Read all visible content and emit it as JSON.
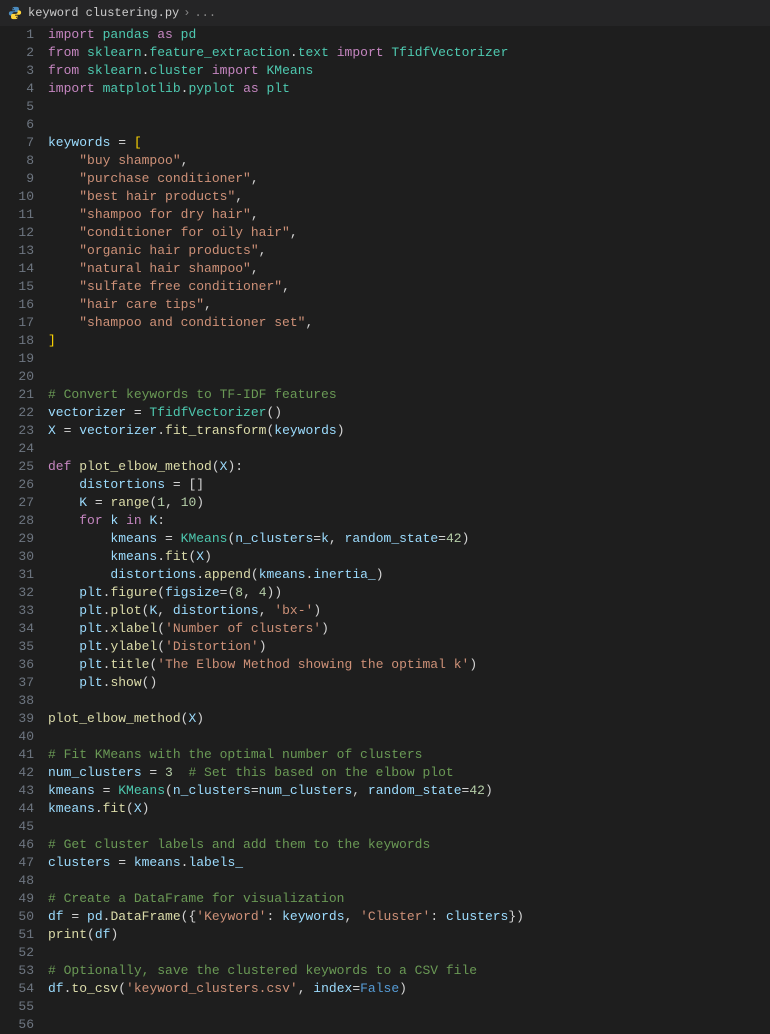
{
  "tab": {
    "filename": "keyword clustering.py",
    "crumb2": "..."
  },
  "lines": [
    {
      "n": 1,
      "ind": 0,
      "tokens": [
        [
          "kw",
          "import"
        ],
        [
          "op",
          " "
        ],
        [
          "mod",
          "pandas"
        ],
        [
          "op",
          " "
        ],
        [
          "kw",
          "as"
        ],
        [
          "op",
          " "
        ],
        [
          "mod",
          "pd"
        ]
      ]
    },
    {
      "n": 2,
      "ind": 0,
      "tokens": [
        [
          "kw",
          "from"
        ],
        [
          "op",
          " "
        ],
        [
          "mod",
          "sklearn"
        ],
        [
          "punc",
          "."
        ],
        [
          "mod",
          "feature_extraction"
        ],
        [
          "punc",
          "."
        ],
        [
          "mod",
          "text"
        ],
        [
          "op",
          " "
        ],
        [
          "kw",
          "import"
        ],
        [
          "op",
          " "
        ],
        [
          "mod",
          "TfidfVectorizer"
        ]
      ]
    },
    {
      "n": 3,
      "ind": 0,
      "tokens": [
        [
          "kw",
          "from"
        ],
        [
          "op",
          " "
        ],
        [
          "mod",
          "sklearn"
        ],
        [
          "punc",
          "."
        ],
        [
          "mod",
          "cluster"
        ],
        [
          "op",
          " "
        ],
        [
          "kw",
          "import"
        ],
        [
          "op",
          " "
        ],
        [
          "mod",
          "KMeans"
        ]
      ]
    },
    {
      "n": 4,
      "ind": 0,
      "tokens": [
        [
          "kw",
          "import"
        ],
        [
          "op",
          " "
        ],
        [
          "mod",
          "matplotlib"
        ],
        [
          "punc",
          "."
        ],
        [
          "mod",
          "pyplot"
        ],
        [
          "op",
          " "
        ],
        [
          "kw",
          "as"
        ],
        [
          "op",
          " "
        ],
        [
          "mod",
          "plt"
        ]
      ]
    },
    {
      "n": 5,
      "ind": 0,
      "tokens": []
    },
    {
      "n": 6,
      "ind": 0,
      "tokens": []
    },
    {
      "n": 7,
      "ind": 0,
      "tokens": [
        [
          "var",
          "keywords"
        ],
        [
          "op",
          " = "
        ],
        [
          "brk",
          "["
        ]
      ]
    },
    {
      "n": 8,
      "ind": 1,
      "tokens": [
        [
          "str",
          "\"buy shampoo\""
        ],
        [
          "punc",
          ","
        ]
      ]
    },
    {
      "n": 9,
      "ind": 1,
      "tokens": [
        [
          "str",
          "\"purchase conditioner\""
        ],
        [
          "punc",
          ","
        ]
      ]
    },
    {
      "n": 10,
      "ind": 1,
      "tokens": [
        [
          "str",
          "\"best hair products\""
        ],
        [
          "punc",
          ","
        ]
      ]
    },
    {
      "n": 11,
      "ind": 1,
      "tokens": [
        [
          "str",
          "\"shampoo for dry hair\""
        ],
        [
          "punc",
          ","
        ]
      ]
    },
    {
      "n": 12,
      "ind": 1,
      "tokens": [
        [
          "str",
          "\"conditioner for oily hair\""
        ],
        [
          "punc",
          ","
        ]
      ]
    },
    {
      "n": 13,
      "ind": 1,
      "tokens": [
        [
          "str",
          "\"organic hair products\""
        ],
        [
          "punc",
          ","
        ]
      ]
    },
    {
      "n": 14,
      "ind": 1,
      "tokens": [
        [
          "str",
          "\"natural hair shampoo\""
        ],
        [
          "punc",
          ","
        ]
      ]
    },
    {
      "n": 15,
      "ind": 1,
      "tokens": [
        [
          "str",
          "\"sulfate free conditioner\""
        ],
        [
          "punc",
          ","
        ]
      ]
    },
    {
      "n": 16,
      "ind": 1,
      "tokens": [
        [
          "str",
          "\"hair care tips\""
        ],
        [
          "punc",
          ","
        ]
      ]
    },
    {
      "n": 17,
      "ind": 1,
      "tokens": [
        [
          "str",
          "\"shampoo and conditioner set\""
        ],
        [
          "punc",
          ","
        ]
      ]
    },
    {
      "n": 18,
      "ind": 0,
      "tokens": [
        [
          "brk",
          "]"
        ]
      ]
    },
    {
      "n": 19,
      "ind": 0,
      "tokens": []
    },
    {
      "n": 20,
      "ind": 0,
      "tokens": []
    },
    {
      "n": 21,
      "ind": 0,
      "tokens": [
        [
          "cmt",
          "# Convert keywords to TF-IDF features"
        ]
      ]
    },
    {
      "n": 22,
      "ind": 0,
      "tokens": [
        [
          "var",
          "vectorizer"
        ],
        [
          "op",
          " = "
        ],
        [
          "mod",
          "TfidfVectorizer"
        ],
        [
          "punc",
          "()"
        ]
      ]
    },
    {
      "n": 23,
      "ind": 0,
      "tokens": [
        [
          "var",
          "X"
        ],
        [
          "op",
          " = "
        ],
        [
          "var",
          "vectorizer"
        ],
        [
          "punc",
          "."
        ],
        [
          "fn",
          "fit_transform"
        ],
        [
          "punc",
          "("
        ],
        [
          "var",
          "keywords"
        ],
        [
          "punc",
          ")"
        ]
      ]
    },
    {
      "n": 24,
      "ind": 0,
      "tokens": []
    },
    {
      "n": 25,
      "ind": 0,
      "tokens": [
        [
          "kw",
          "def"
        ],
        [
          "op",
          " "
        ],
        [
          "fn",
          "plot_elbow_method"
        ],
        [
          "punc",
          "("
        ],
        [
          "var",
          "X"
        ],
        [
          "punc",
          "):"
        ]
      ]
    },
    {
      "n": 26,
      "ind": 1,
      "tokens": [
        [
          "var",
          "distortions"
        ],
        [
          "op",
          " = "
        ],
        [
          "punc",
          "[]"
        ]
      ]
    },
    {
      "n": 27,
      "ind": 1,
      "tokens": [
        [
          "var",
          "K"
        ],
        [
          "op",
          " = "
        ],
        [
          "fn",
          "range"
        ],
        [
          "punc",
          "("
        ],
        [
          "num",
          "1"
        ],
        [
          "punc",
          ", "
        ],
        [
          "num",
          "10"
        ],
        [
          "punc",
          ")"
        ]
      ]
    },
    {
      "n": 28,
      "ind": 1,
      "tokens": [
        [
          "kw",
          "for"
        ],
        [
          "op",
          " "
        ],
        [
          "var",
          "k"
        ],
        [
          "op",
          " "
        ],
        [
          "kw",
          "in"
        ],
        [
          "op",
          " "
        ],
        [
          "var",
          "K"
        ],
        [
          "punc",
          ":"
        ]
      ]
    },
    {
      "n": 29,
      "ind": 2,
      "tokens": [
        [
          "var",
          "kmeans"
        ],
        [
          "op",
          " = "
        ],
        [
          "mod",
          "KMeans"
        ],
        [
          "punc",
          "("
        ],
        [
          "var",
          "n_clusters"
        ],
        [
          "op",
          "="
        ],
        [
          "var",
          "k"
        ],
        [
          "punc",
          ", "
        ],
        [
          "var",
          "random_state"
        ],
        [
          "op",
          "="
        ],
        [
          "num",
          "42"
        ],
        [
          "punc",
          ")"
        ]
      ]
    },
    {
      "n": 30,
      "ind": 2,
      "tokens": [
        [
          "var",
          "kmeans"
        ],
        [
          "punc",
          "."
        ],
        [
          "fn",
          "fit"
        ],
        [
          "punc",
          "("
        ],
        [
          "var",
          "X"
        ],
        [
          "punc",
          ")"
        ]
      ]
    },
    {
      "n": 31,
      "ind": 2,
      "tokens": [
        [
          "var",
          "distortions"
        ],
        [
          "punc",
          "."
        ],
        [
          "fn",
          "append"
        ],
        [
          "punc",
          "("
        ],
        [
          "var",
          "kmeans"
        ],
        [
          "punc",
          "."
        ],
        [
          "var",
          "inertia_"
        ],
        [
          "punc",
          ")"
        ]
      ]
    },
    {
      "n": 32,
      "ind": 1,
      "tokens": [
        [
          "var",
          "plt"
        ],
        [
          "punc",
          "."
        ],
        [
          "fn",
          "figure"
        ],
        [
          "punc",
          "("
        ],
        [
          "var",
          "figsize"
        ],
        [
          "op",
          "="
        ],
        [
          "punc",
          "("
        ],
        [
          "num",
          "8"
        ],
        [
          "punc",
          ", "
        ],
        [
          "num",
          "4"
        ],
        [
          "punc",
          "))"
        ]
      ]
    },
    {
      "n": 33,
      "ind": 1,
      "tokens": [
        [
          "var",
          "plt"
        ],
        [
          "punc",
          "."
        ],
        [
          "fn",
          "plot"
        ],
        [
          "punc",
          "("
        ],
        [
          "var",
          "K"
        ],
        [
          "punc",
          ", "
        ],
        [
          "var",
          "distortions"
        ],
        [
          "punc",
          ", "
        ],
        [
          "str",
          "'bx-'"
        ],
        [
          "punc",
          ")"
        ]
      ]
    },
    {
      "n": 34,
      "ind": 1,
      "tokens": [
        [
          "var",
          "plt"
        ],
        [
          "punc",
          "."
        ],
        [
          "fn",
          "xlabel"
        ],
        [
          "punc",
          "("
        ],
        [
          "str",
          "'Number of clusters'"
        ],
        [
          "punc",
          ")"
        ]
      ]
    },
    {
      "n": 35,
      "ind": 1,
      "tokens": [
        [
          "var",
          "plt"
        ],
        [
          "punc",
          "."
        ],
        [
          "fn",
          "ylabel"
        ],
        [
          "punc",
          "("
        ],
        [
          "str",
          "'Distortion'"
        ],
        [
          "punc",
          ")"
        ]
      ]
    },
    {
      "n": 36,
      "ind": 1,
      "tokens": [
        [
          "var",
          "plt"
        ],
        [
          "punc",
          "."
        ],
        [
          "fn",
          "title"
        ],
        [
          "punc",
          "("
        ],
        [
          "str",
          "'The Elbow Method showing the optimal k'"
        ],
        [
          "punc",
          ")"
        ]
      ]
    },
    {
      "n": 37,
      "ind": 1,
      "tokens": [
        [
          "var",
          "plt"
        ],
        [
          "punc",
          "."
        ],
        [
          "fn",
          "show"
        ],
        [
          "punc",
          "()"
        ]
      ]
    },
    {
      "n": 38,
      "ind": 0,
      "tokens": []
    },
    {
      "n": 39,
      "ind": 0,
      "tokens": [
        [
          "fn",
          "plot_elbow_method"
        ],
        [
          "punc",
          "("
        ],
        [
          "var",
          "X"
        ],
        [
          "punc",
          ")"
        ]
      ]
    },
    {
      "n": 40,
      "ind": 0,
      "tokens": []
    },
    {
      "n": 41,
      "ind": 0,
      "tokens": [
        [
          "cmt",
          "# Fit KMeans with the optimal number of clusters"
        ]
      ]
    },
    {
      "n": 42,
      "ind": 0,
      "tokens": [
        [
          "var",
          "num_clusters"
        ],
        [
          "op",
          " = "
        ],
        [
          "num",
          "3"
        ],
        [
          "op",
          "  "
        ],
        [
          "cmt",
          "# Set this based on the elbow plot"
        ]
      ]
    },
    {
      "n": 43,
      "ind": 0,
      "tokens": [
        [
          "var",
          "kmeans"
        ],
        [
          "op",
          " = "
        ],
        [
          "mod",
          "KMeans"
        ],
        [
          "punc",
          "("
        ],
        [
          "var",
          "n_clusters"
        ],
        [
          "op",
          "="
        ],
        [
          "var",
          "num_clusters"
        ],
        [
          "punc",
          ", "
        ],
        [
          "var",
          "random_state"
        ],
        [
          "op",
          "="
        ],
        [
          "num",
          "42"
        ],
        [
          "punc",
          ")"
        ]
      ]
    },
    {
      "n": 44,
      "ind": 0,
      "tokens": [
        [
          "var",
          "kmeans"
        ],
        [
          "punc",
          "."
        ],
        [
          "fn",
          "fit"
        ],
        [
          "punc",
          "("
        ],
        [
          "var",
          "X"
        ],
        [
          "punc",
          ")"
        ]
      ]
    },
    {
      "n": 45,
      "ind": 0,
      "tokens": []
    },
    {
      "n": 46,
      "ind": 0,
      "tokens": [
        [
          "cmt",
          "# Get cluster labels and add them to the keywords"
        ]
      ]
    },
    {
      "n": 47,
      "ind": 0,
      "tokens": [
        [
          "var",
          "clusters"
        ],
        [
          "op",
          " = "
        ],
        [
          "var",
          "kmeans"
        ],
        [
          "punc",
          "."
        ],
        [
          "var",
          "labels_"
        ]
      ]
    },
    {
      "n": 48,
      "ind": 0,
      "tokens": []
    },
    {
      "n": 49,
      "ind": 0,
      "tokens": [
        [
          "cmt",
          "# Create a DataFrame for visualization"
        ]
      ]
    },
    {
      "n": 50,
      "ind": 0,
      "tokens": [
        [
          "var",
          "df"
        ],
        [
          "op",
          " = "
        ],
        [
          "var",
          "pd"
        ],
        [
          "punc",
          "."
        ],
        [
          "fn",
          "DataFrame"
        ],
        [
          "punc",
          "({"
        ],
        [
          "str",
          "'Keyword'"
        ],
        [
          "punc",
          ": "
        ],
        [
          "var",
          "keywords"
        ],
        [
          "punc",
          ", "
        ],
        [
          "str",
          "'Cluster'"
        ],
        [
          "punc",
          ": "
        ],
        [
          "var",
          "clusters"
        ],
        [
          "punc",
          "})"
        ]
      ]
    },
    {
      "n": 51,
      "ind": 0,
      "tokens": [
        [
          "fn",
          "print"
        ],
        [
          "punc",
          "("
        ],
        [
          "var",
          "df"
        ],
        [
          "punc",
          ")"
        ]
      ]
    },
    {
      "n": 52,
      "ind": 0,
      "tokens": []
    },
    {
      "n": 53,
      "ind": 0,
      "tokens": [
        [
          "cmt",
          "# Optionally, save the clustered keywords to a CSV file"
        ]
      ]
    },
    {
      "n": 54,
      "ind": 0,
      "tokens": [
        [
          "var",
          "df"
        ],
        [
          "punc",
          "."
        ],
        [
          "fn",
          "to_csv"
        ],
        [
          "punc",
          "("
        ],
        [
          "str",
          "'keyword_clusters.csv'"
        ],
        [
          "punc",
          ", "
        ],
        [
          "var",
          "index"
        ],
        [
          "op",
          "="
        ],
        [
          "bool",
          "False"
        ],
        [
          "punc",
          ")"
        ]
      ]
    },
    {
      "n": 55,
      "ind": 0,
      "tokens": []
    },
    {
      "n": 56,
      "ind": 0,
      "tokens": []
    }
  ]
}
